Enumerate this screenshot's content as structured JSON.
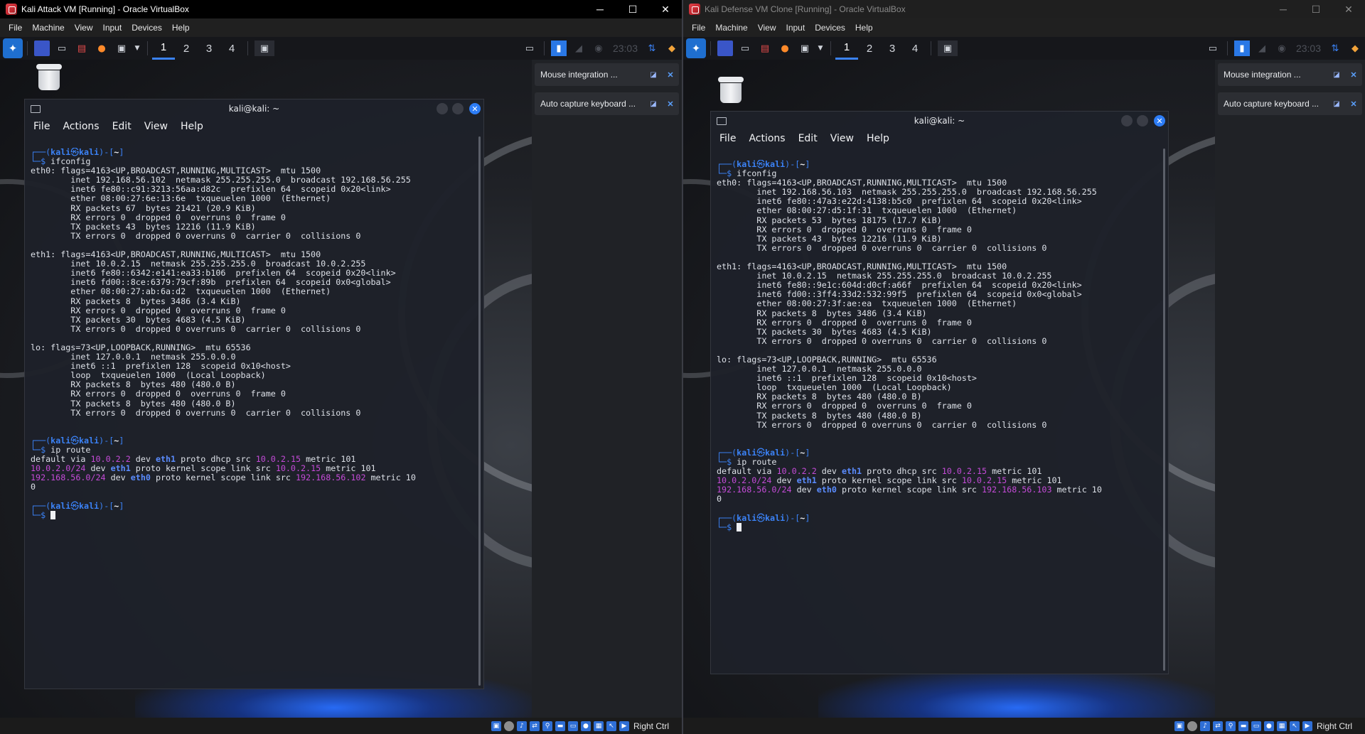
{
  "left": {
    "window_title": "Kali Attack VM [Running] - Oracle VirtualBox",
    "menu": [
      "File",
      "Machine",
      "View",
      "Input",
      "Devices",
      "Help"
    ],
    "workspaces": [
      "1",
      "2",
      "3",
      "4"
    ],
    "clock": "23:03",
    "notifications": [
      "Mouse integration ...",
      "Auto capture keyboard ..."
    ],
    "terminal_title": "kali@kali: ~",
    "terminal_menu": [
      "File",
      "Actions",
      "Edit",
      "View",
      "Help"
    ],
    "host_key": "Right Ctrl",
    "output": {
      "ifconfig_cmd": "ifconfig",
      "eth0_l1": "eth0: flags=4163<UP,BROADCAST,RUNNING,MULTICAST>  mtu 1500",
      "eth0_l2": "        inet 192.168.56.102  netmask 255.255.255.0  broadcast 192.168.56.255",
      "eth0_l3": "        inet6 fe80::c91:3213:56aa:d82c  prefixlen 64  scopeid 0x20<link>",
      "eth0_l4": "        ether 08:00:27:6e:13:6e  txqueuelen 1000  (Ethernet)",
      "eth0_l5": "        RX packets 67  bytes 21421 (20.9 KiB)",
      "eth0_l6": "        RX errors 0  dropped 0  overruns 0  frame 0",
      "eth0_l7": "        TX packets 43  bytes 12216 (11.9 KiB)",
      "eth0_l8": "        TX errors 0  dropped 0 overruns 0  carrier 0  collisions 0",
      "eth1_l1": "eth1: flags=4163<UP,BROADCAST,RUNNING,MULTICAST>  mtu 1500",
      "eth1_l2": "        inet 10.0.2.15  netmask 255.255.255.0  broadcast 10.0.2.255",
      "eth1_l3": "        inet6 fe80::6342:e141:ea33:b106  prefixlen 64  scopeid 0x20<link>",
      "eth1_l4": "        inet6 fd00::8ce:6379:79cf:89b  prefixlen 64  scopeid 0x0<global>",
      "eth1_l5": "        ether 08:00:27:ab:6a:d2  txqueuelen 1000  (Ethernet)",
      "eth1_l6": "        RX packets 8  bytes 3486 (3.4 KiB)",
      "eth1_l7": "        RX errors 0  dropped 0  overruns 0  frame 0",
      "eth1_l8": "        TX packets 30  bytes 4683 (4.5 KiB)",
      "eth1_l9": "        TX errors 0  dropped 0 overruns 0  carrier 0  collisions 0",
      "lo_l1": "lo: flags=73<UP,LOOPBACK,RUNNING>  mtu 65536",
      "lo_l2": "        inet 127.0.0.1  netmask 255.0.0.0",
      "lo_l3": "        inet6 ::1  prefixlen 128  scopeid 0x10<host>",
      "lo_l4": "        loop  txqueuelen 1000  (Local Loopback)",
      "lo_l5": "        RX packets 8  bytes 480 (480.0 B)",
      "lo_l6": "        RX errors 0  dropped 0  overruns 0  frame 0",
      "lo_l7": "        TX packets 8  bytes 480 (480.0 B)",
      "lo_l8": "        TX errors 0  dropped 0 overruns 0  carrier 0  collisions 0",
      "route_cmd": "ip route",
      "r1_a": "default via ",
      "r1_ip1": "10.0.2.2",
      "r1_b": " dev ",
      "r1_dev": "eth1",
      "r1_c": " proto dhcp src ",
      "r1_ip2": "10.0.2.15",
      "r1_d": " metric 101",
      "r2_ip1": "10.0.2.0/24",
      "r2_b": " dev ",
      "r2_dev": "eth1",
      "r2_c": " proto kernel scope link src ",
      "r2_ip2": "10.0.2.15",
      "r2_d": " metric 101",
      "r3_ip1": "192.168.56.0/24",
      "r3_b": " dev ",
      "r3_dev": "eth0",
      "r3_c": " proto kernel scope link src ",
      "r3_ip2": "192.168.56.102",
      "r3_d": " metric 10",
      "r3_wrap": "0"
    }
  },
  "right": {
    "window_title": "Kali Defense VM Clone [Running] - Oracle VirtualBox",
    "menu": [
      "File",
      "Machine",
      "View",
      "Input",
      "Devices",
      "Help"
    ],
    "workspaces": [
      "1",
      "2",
      "3",
      "4"
    ],
    "clock": "23:03",
    "notifications": [
      "Mouse integration ...",
      "Auto capture keyboard ..."
    ],
    "terminal_title": "kali@kali: ~",
    "terminal_menu": [
      "File",
      "Actions",
      "Edit",
      "View",
      "Help"
    ],
    "host_key": "Right Ctrl",
    "output": {
      "ifconfig_cmd": "ifconfig",
      "eth0_l1": "eth0: flags=4163<UP,BROADCAST,RUNNING,MULTICAST>  mtu 1500",
      "eth0_l2": "        inet 192.168.56.103  netmask 255.255.255.0  broadcast 192.168.56.255",
      "eth0_l3": "        inet6 fe80::47a3:e22d:4138:b5c0  prefixlen 64  scopeid 0x20<link>",
      "eth0_l4": "        ether 08:00:27:d5:1f:31  txqueuelen 1000  (Ethernet)",
      "eth0_l5": "        RX packets 53  bytes 18175 (17.7 KiB)",
      "eth0_l6": "        RX errors 0  dropped 0  overruns 0  frame 0",
      "eth0_l7": "        TX packets 43  bytes 12216 (11.9 KiB)",
      "eth0_l8": "        TX errors 0  dropped 0 overruns 0  carrier 0  collisions 0",
      "eth1_l1": "eth1: flags=4163<UP,BROADCAST,RUNNING,MULTICAST>  mtu 1500",
      "eth1_l2": "        inet 10.0.2.15  netmask 255.255.255.0  broadcast 10.0.2.255",
      "eth1_l3": "        inet6 fe80::9e1c:604d:d0cf:a66f  prefixlen 64  scopeid 0x20<link>",
      "eth1_l4": "        inet6 fd00::3ff4:33d2:532:99f5  prefixlen 64  scopeid 0x0<global>",
      "eth1_l5": "        ether 08:00:27:3f:ae:ea  txqueuelen 1000  (Ethernet)",
      "eth1_l6": "        RX packets 8  bytes 3486 (3.4 KiB)",
      "eth1_l7": "        RX errors 0  dropped 0  overruns 0  frame 0",
      "eth1_l8": "        TX packets 30  bytes 4683 (4.5 KiB)",
      "eth1_l9": "        TX errors 0  dropped 0 overruns 0  carrier 0  collisions 0",
      "lo_l1": "lo: flags=73<UP,LOOPBACK,RUNNING>  mtu 65536",
      "lo_l2": "        inet 127.0.0.1  netmask 255.0.0.0",
      "lo_l3": "        inet6 ::1  prefixlen 128  scopeid 0x10<host>",
      "lo_l4": "        loop  txqueuelen 1000  (Local Loopback)",
      "lo_l5": "        RX packets 8  bytes 480 (480.0 B)",
      "lo_l6": "        RX errors 0  dropped 0  overruns 0  frame 0",
      "lo_l7": "        TX packets 8  bytes 480 (480.0 B)",
      "lo_l8": "        TX errors 0  dropped 0 overruns 0  carrier 0  collisions 0",
      "route_cmd": "ip route",
      "r1_a": "default via ",
      "r1_ip1": "10.0.2.2",
      "r1_b": " dev ",
      "r1_dev": "eth1",
      "r1_c": " proto dhcp src ",
      "r1_ip2": "10.0.2.15",
      "r1_d": " metric 101",
      "r2_ip1": "10.0.2.0/24",
      "r2_b": " dev ",
      "r2_dev": "eth1",
      "r2_c": " proto kernel scope link src ",
      "r2_ip2": "10.0.2.15",
      "r2_d": " metric 101",
      "r3_ip1": "192.168.56.0/24",
      "r3_b": " dev ",
      "r3_dev": "eth0",
      "r3_c": " proto kernel scope link src ",
      "r3_ip2": "192.168.56.103",
      "r3_d": " metric 10",
      "r3_wrap": "0"
    }
  },
  "prompt": {
    "box1": "┌──(",
    "user": "kali",
    "at": "㉿",
    "host": "kali",
    "mid": ")-[",
    "dir": "~",
    "end": "]",
    "box2": "└─",
    "dollar": "$ "
  },
  "win_icons": {
    "minimize": "─",
    "maximize": "☐",
    "close": "✕"
  }
}
